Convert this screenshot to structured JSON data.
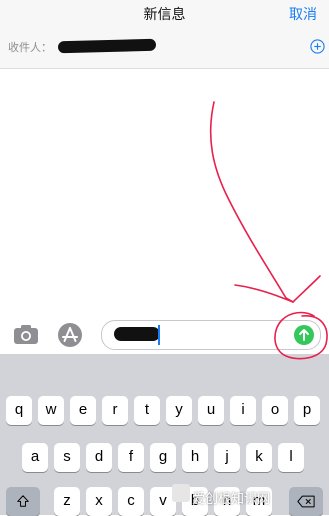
{
  "nav": {
    "title": "新信息",
    "cancel_label": "取消"
  },
  "recipient": {
    "label": "收件人："
  },
  "keyboard": {
    "rows": [
      [
        "q",
        "w",
        "e",
        "r",
        "t",
        "y",
        "u",
        "i",
        "o",
        "p"
      ],
      [
        "a",
        "s",
        "d",
        "f",
        "g",
        "h",
        "j",
        "k",
        "l"
      ],
      [
        "z",
        "x",
        "c",
        "v",
        "b",
        "n",
        "m"
      ]
    ]
  },
  "watermark": {
    "text": "爱创根知识网"
  },
  "colors": {
    "accent": "#1a7cf5",
    "send": "#34c759",
    "annotation": "#e8204a"
  }
}
